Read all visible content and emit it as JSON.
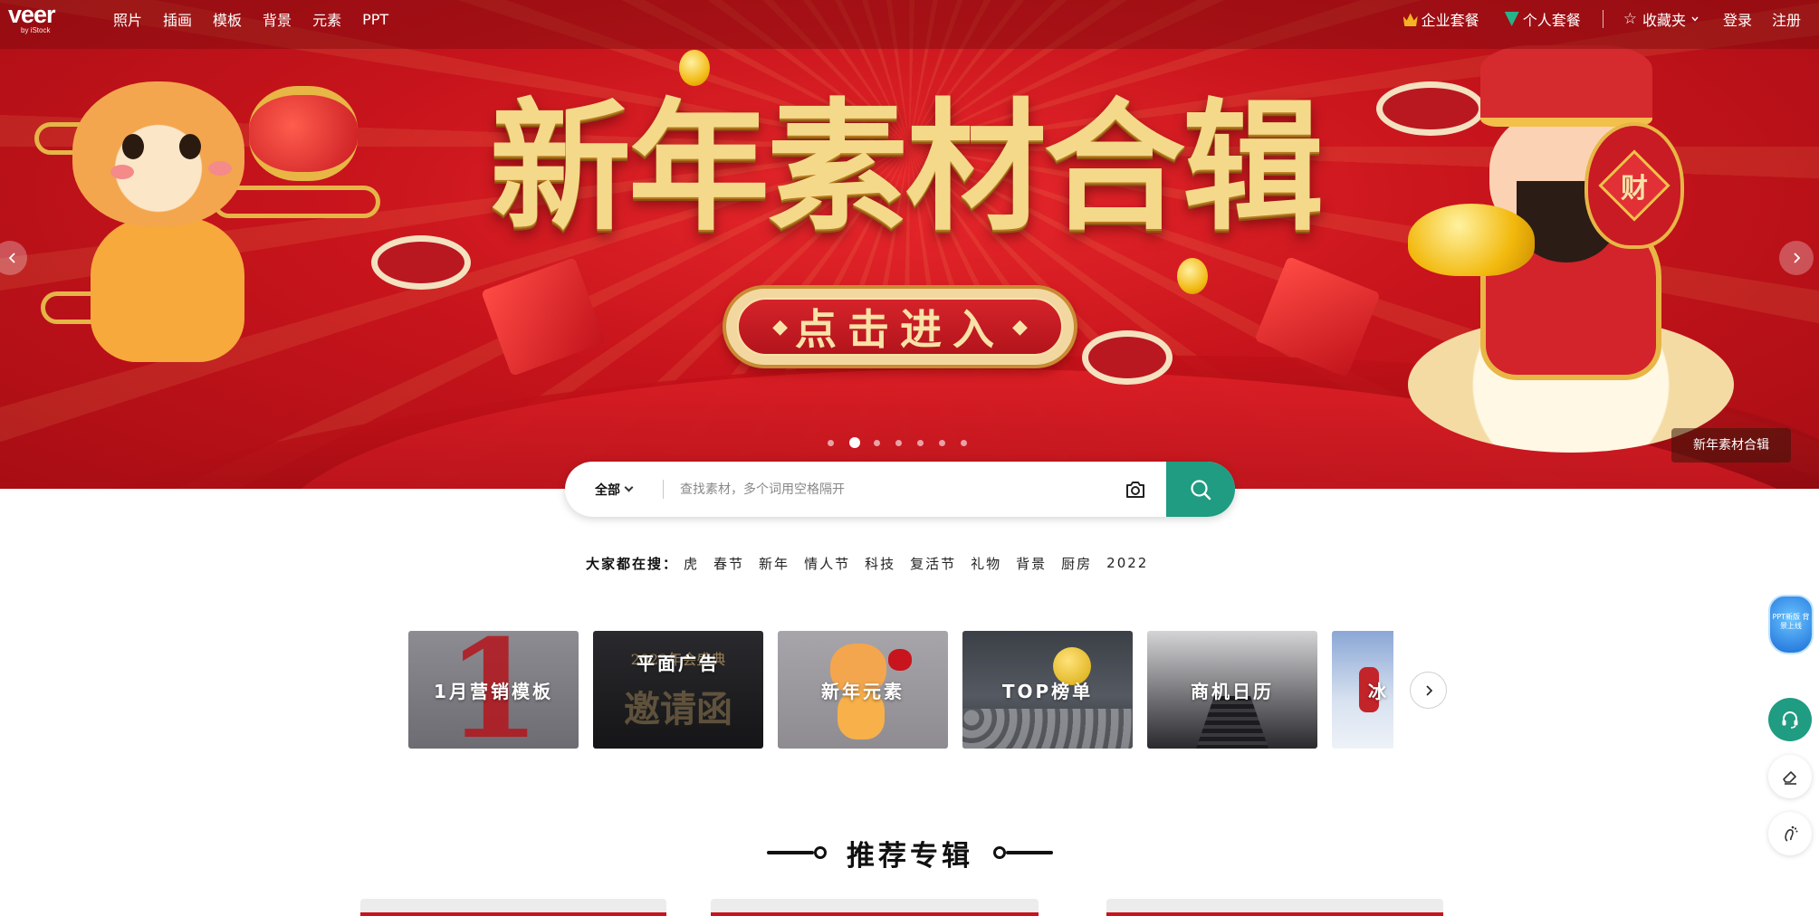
{
  "brand": {
    "logo_text": "veer",
    "logo_sub": "by iStock"
  },
  "nav": {
    "left_items": [
      "照片",
      "插画",
      "模板",
      "背景",
      "元素",
      "PPT"
    ],
    "enterprise": "企业套餐",
    "personal": "个人套餐",
    "favorites": "收藏夹",
    "login": "登录",
    "register": "注册"
  },
  "hero": {
    "title": "新年素材合辑",
    "cta": "点击进入",
    "cta_diamond_left": "◆",
    "cta_diamond_right": "◆",
    "bag_char": "财",
    "tag": "新年素材合辑",
    "slides_count": 7,
    "active_slide": 2
  },
  "search": {
    "scope": "全部",
    "placeholder": "查找素材，多个词用空格隔开",
    "value": ""
  },
  "hot_search": {
    "label": "大家都在搜：",
    "terms": [
      "虎",
      "春节",
      "新年",
      "情人节",
      "科技",
      "复活节",
      "礼物",
      "背景",
      "厨房",
      "2022"
    ]
  },
  "categories": [
    {
      "label": "1月营销模板",
      "bg_text": "1"
    },
    {
      "label": "平面广告",
      "bg_text": "2022年会盛典",
      "bg_text2": "邀请函"
    },
    {
      "label": "新年元素"
    },
    {
      "label": "TOP榜单"
    },
    {
      "label": "商机日历"
    },
    {
      "label": "冰"
    }
  ],
  "recommend": {
    "title": "推荐专辑"
  },
  "float": {
    "ad_text": "PPT新版 背景上线"
  },
  "colors": {
    "accent": "#1f9c82",
    "hero_red": "#c8141c",
    "gold": "#f5d98a"
  }
}
